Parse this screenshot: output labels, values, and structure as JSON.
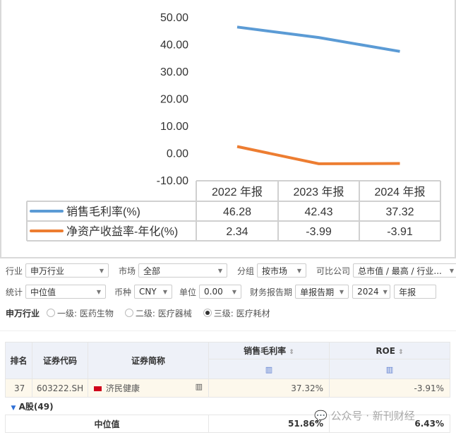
{
  "chart_data": {
    "type": "line",
    "categories": [
      "2022 年报",
      "2023 年报",
      "2024 年报"
    ],
    "series": [
      {
        "name": "销售毛利率(%)",
        "values": [
          46.28,
          42.43,
          37.32
        ],
        "color": "#5b9bd5",
        "labels": [
          "46.28",
          "42.43",
          "37.32"
        ]
      },
      {
        "name": "净资产收益率-年化(%)",
        "values": [
          2.34,
          -3.99,
          -3.91
        ],
        "color": "#ed7d31",
        "labels": [
          "2.34",
          "-3.99",
          "-3.91"
        ]
      }
    ],
    "ylim": [
      -10,
      50
    ],
    "yticks": [
      "50.00",
      "40.00",
      "30.00",
      "20.00",
      "10.00",
      "0.00",
      "-10.00"
    ],
    "grid": false,
    "legend": "data-table-below"
  },
  "filters": {
    "industry_label": "行业",
    "industry_value": "申万行业",
    "market_label": "市场",
    "market_value": "全部",
    "group_label": "分组",
    "group_value": "按市场",
    "peer_label": "可比公司",
    "peer_value": "总市值 / 最高 / 行业...",
    "stat_label": "统计",
    "stat_value": "中位值",
    "currency_label": "币种",
    "currency_value": "CNY",
    "unit_label": "单位",
    "unit_value": "0.00",
    "period_label": "财务报告期",
    "period_type": "单报告期",
    "period_year": "2024",
    "period_kind": "年报",
    "level_title": "申万行业",
    "levels": [
      {
        "label": "一级: 医药生物",
        "checked": false
      },
      {
        "label": "二级: 医疗器械",
        "checked": false
      },
      {
        "label": "三级: 医疗耗材",
        "checked": true
      }
    ]
  },
  "table": {
    "headers": {
      "rank": "排名",
      "code": "证券代码",
      "name": "证券简称",
      "gross": "销售毛利率",
      "roe": "ROE"
    },
    "row": {
      "rank": "37",
      "code": "603222.SH",
      "name": "济民健康",
      "gross": "37.32%",
      "roe": "-3.91%"
    },
    "group": "A股(49)",
    "median": {
      "label": "中位值",
      "gross": "51.86%",
      "roe": "6.43%"
    }
  },
  "watermark": "公众号 · 新刊财经"
}
